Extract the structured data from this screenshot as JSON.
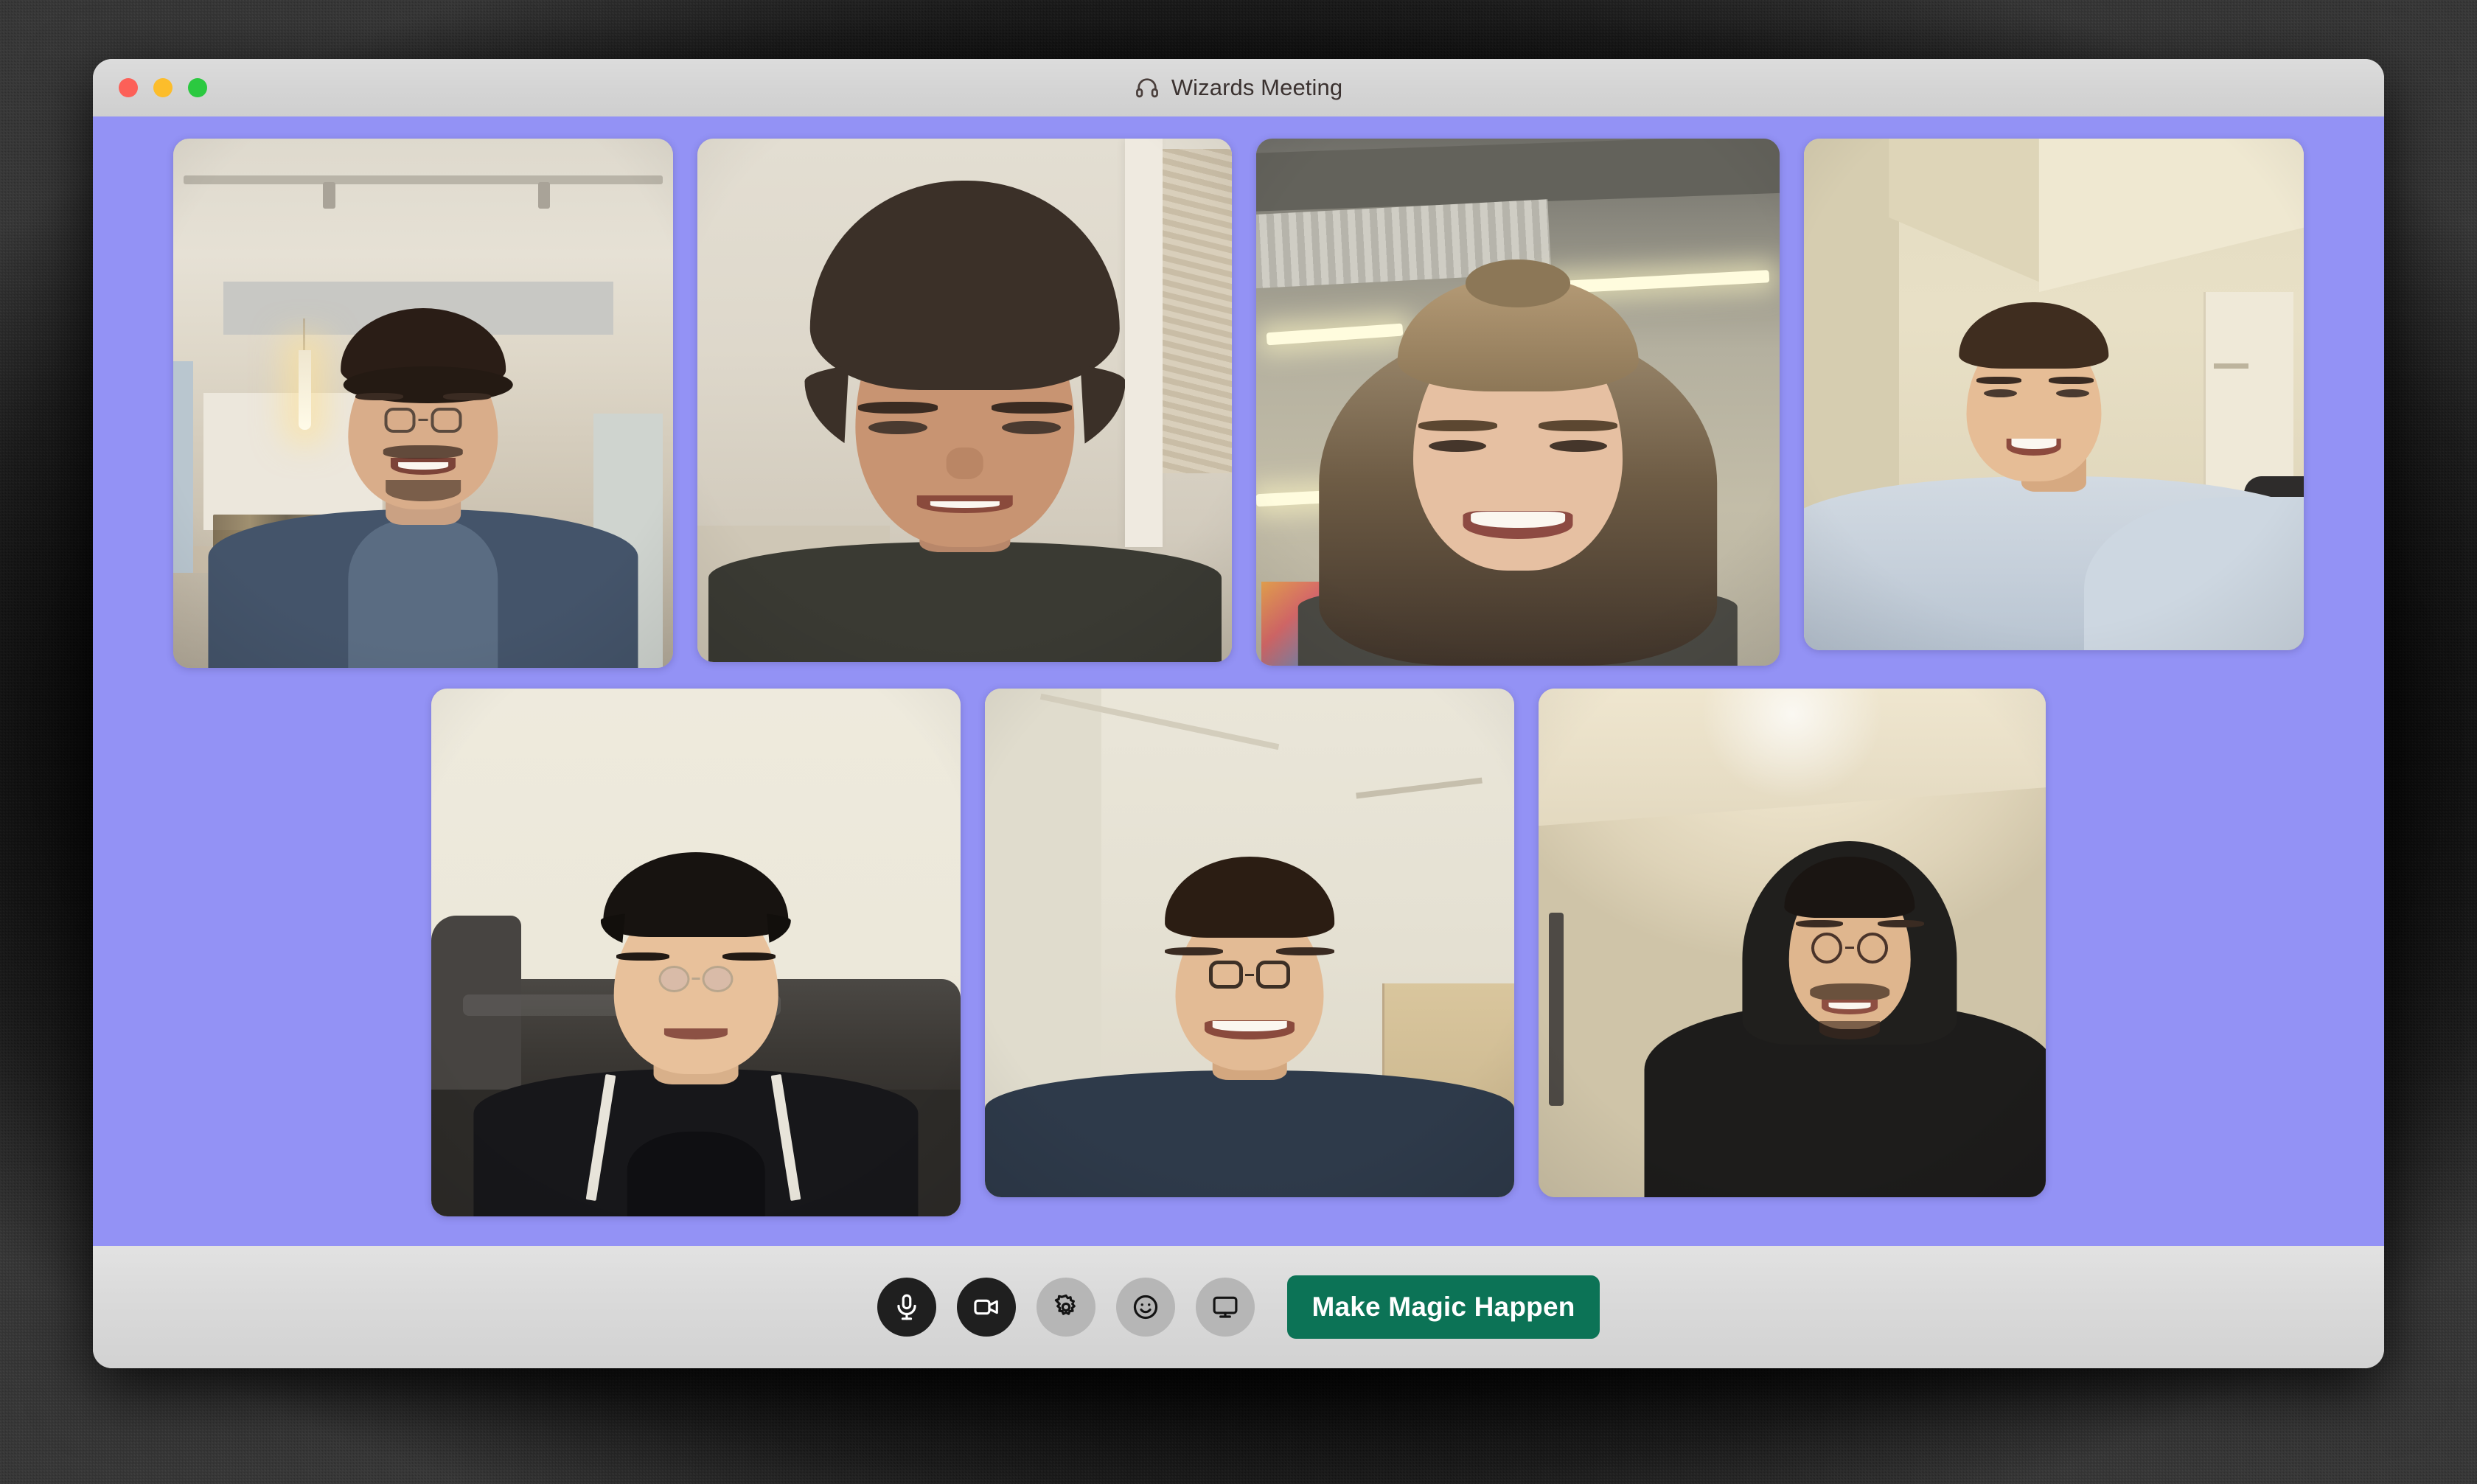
{
  "window": {
    "title": "Wizards Meeting",
    "title_icon": "headphones-icon",
    "traffic_lights": [
      {
        "name": "close",
        "color": "#fc6058"
      },
      {
        "name": "minimize",
        "color": "#fcbd2b"
      },
      {
        "name": "maximize",
        "color": "#2bc940"
      }
    ]
  },
  "stage": {
    "background_color": "#9392F5",
    "layout": "2 rows: 4 tiles on top, 3 tiles centered below",
    "participants": [
      {
        "index": 1,
        "row": 1,
        "scene": "loft-kitchen-pendant-light",
        "description": "person with glasses, beard, denim shirt"
      },
      {
        "index": 2,
        "row": 1,
        "scene": "bright-wall-doorway",
        "description": "person with curly dark hair, dark tee"
      },
      {
        "index": 3,
        "row": 1,
        "scene": "warehouse-ceiling-fluorescent-lights",
        "description": "person with long light-brown hair, smiling"
      },
      {
        "index": 4,
        "row": 1,
        "scene": "beige-bedroom-corner-closet-door",
        "description": "person in light gray long-sleeve shirt"
      },
      {
        "index": 5,
        "row": 2,
        "scene": "black-leather-couch",
        "description": "person with glasses, black crewneck sweater"
      },
      {
        "index": 6,
        "row": 2,
        "scene": "white-wall-wood-dresser",
        "description": "person with glasses, navy shirt"
      },
      {
        "index": 7,
        "row": 2,
        "scene": "warm-plain-wall-overhead-light",
        "description": "person with glasses in a black hoodie"
      }
    ]
  },
  "toolbar": {
    "buttons": [
      {
        "id": "microphone",
        "icon": "microphone-icon",
        "style": "dark",
        "label": "Microphone"
      },
      {
        "id": "camera",
        "icon": "video-camera-icon",
        "style": "dark",
        "label": "Camera"
      },
      {
        "id": "settings",
        "icon": "gear-icon",
        "style": "gray",
        "label": "Settings"
      },
      {
        "id": "reactions",
        "icon": "smiley-face-icon",
        "style": "gray",
        "label": "Reactions"
      },
      {
        "id": "share",
        "icon": "monitor-screen-icon",
        "style": "gray",
        "label": "Share screen"
      }
    ],
    "primary_action": {
      "label": "Make Magic Happen",
      "color": "#0C7356",
      "text_color": "#FFFFFF"
    },
    "dark_button_color": "#1F1F1F",
    "gray_button_color": "#B6B6B6",
    "background_color": "#DADADA"
  }
}
